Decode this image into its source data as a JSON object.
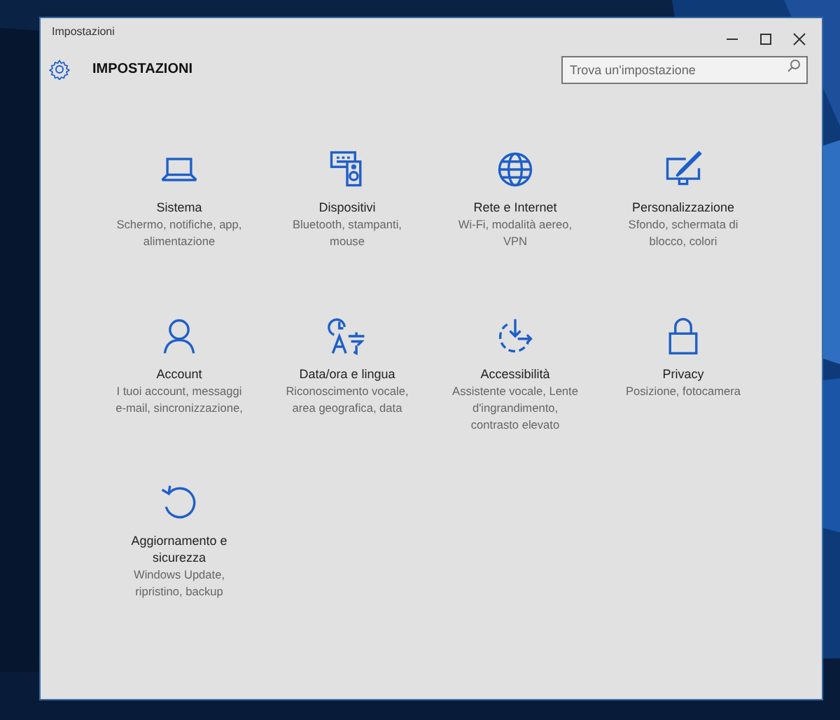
{
  "window": {
    "title": "Impostazioni"
  },
  "header": {
    "title": "IMPOSTAZIONI",
    "search": {
      "placeholder": "Trova un'impostazione"
    }
  },
  "tiles": [
    {
      "title": "Sistema",
      "description": "Schermo, notifiche, app, alimentazione"
    },
    {
      "title": "Dispositivi",
      "description": "Bluetooth, stampanti, mouse"
    },
    {
      "title": "Rete e Internet",
      "description": "Wi-Fi, modalità aereo, VPN"
    },
    {
      "title": "Personalizzazione",
      "description": "Sfondo, schermata di blocco, colori"
    },
    {
      "title": "Account",
      "description": "I tuoi account, messaggi e-mail, sincronizzazione,"
    },
    {
      "title": "Data/ora e lingua",
      "description": "Riconoscimento vocale, area geografica, data"
    },
    {
      "title": "Accessibilità",
      "description": "Assistente vocale, Lente d'ingrandimento, contrasto elevato"
    },
    {
      "title": "Privacy",
      "description": "Posizione, fotocamera"
    },
    {
      "title": "Aggiornamento e sicurezza",
      "description": "Windows Update, ripristino, backup"
    }
  ]
}
